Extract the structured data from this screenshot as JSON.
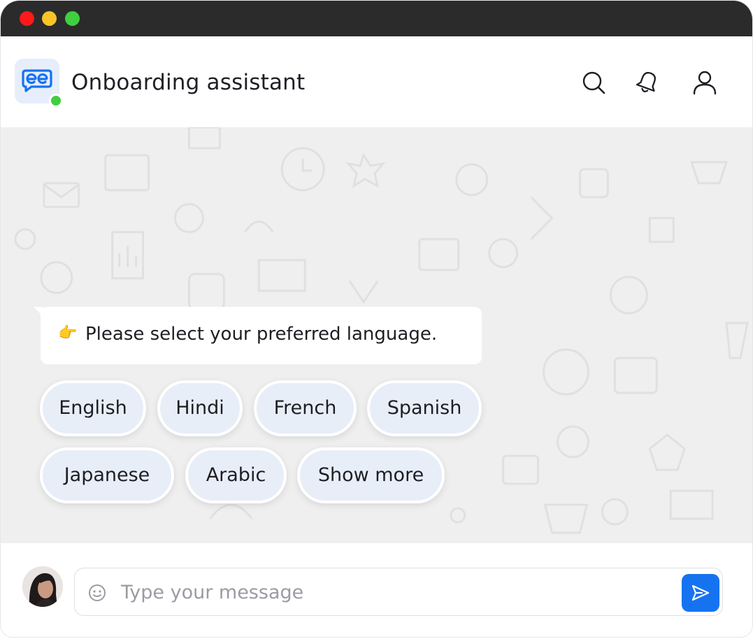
{
  "window": {
    "controls": [
      "close",
      "minimize",
      "maximize"
    ],
    "colors": {
      "close": "#fe1a1a",
      "minimize": "#f8c428",
      "maximize": "#3fcf3f"
    }
  },
  "header": {
    "title": "Onboarding assistant",
    "logo_icon": "chat-bubble-logo-icon",
    "status": "online",
    "actions": [
      {
        "icon": "search-icon"
      },
      {
        "icon": "bell-icon"
      },
      {
        "icon": "user-icon"
      }
    ]
  },
  "chat": {
    "message": {
      "emoji": "👉",
      "text": "Please select your preferred language."
    },
    "options": [
      {
        "label": "English"
      },
      {
        "label": "Hindi"
      },
      {
        "label": "French"
      },
      {
        "label": "Spanish"
      },
      {
        "label": "Japanese"
      },
      {
        "label": "Arabic"
      },
      {
        "label": "Show more"
      }
    ]
  },
  "composer": {
    "placeholder": "Type your message",
    "value": "",
    "emoji_icon": "smiley-icon",
    "send_icon": "send-icon"
  },
  "colors": {
    "accent": "#1673f0",
    "chip_bg": "#e8eef8",
    "chat_bg": "#efefef",
    "online": "#3fcf3f"
  }
}
